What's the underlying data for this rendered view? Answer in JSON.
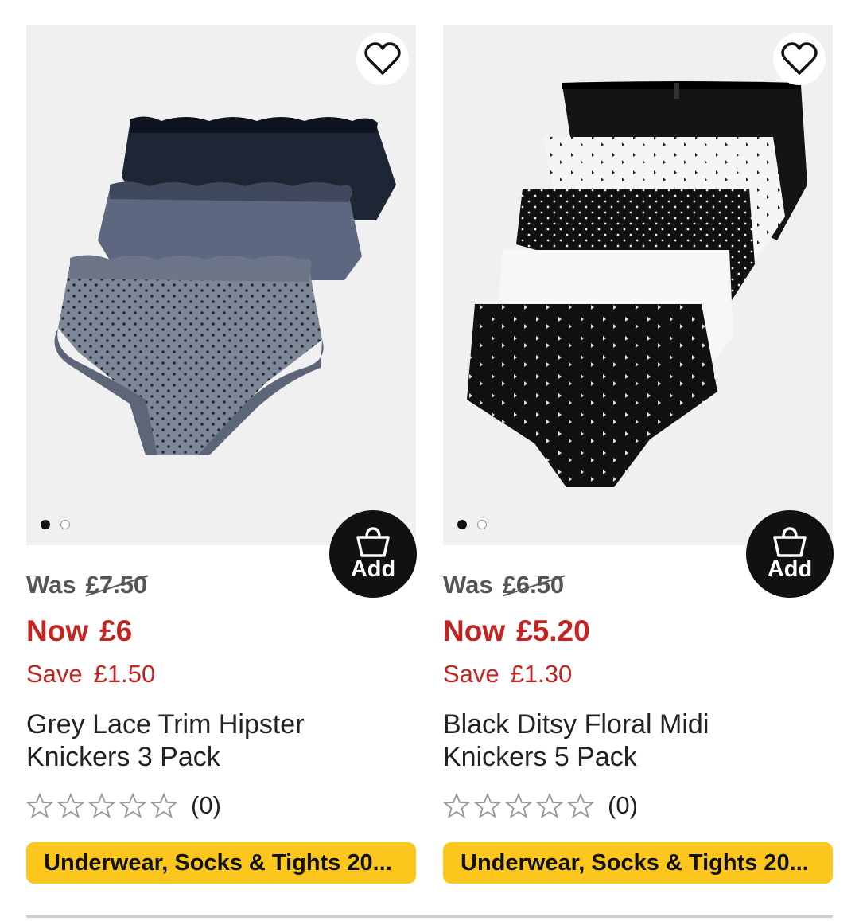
{
  "products": [
    {
      "was_label": "Was",
      "was_price": "£7.50",
      "now_label": "Now",
      "now_price": "£6",
      "save_label": "Save",
      "save_amount": "£1.50",
      "title_line1": "Grey Lace Trim Hipster",
      "title_line2": "Knickers 3 Pack",
      "rating_stars": 0,
      "review_count": "(0)",
      "add_label": "Add",
      "promo": "Underwear, Socks & Tights 20...",
      "image_icon": "product-image-grey-lace-knickers",
      "carousel_active": 1,
      "carousel_total": 2
    },
    {
      "was_label": "Was",
      "was_price": "£6.50",
      "now_label": "Now",
      "now_price": "£5.20",
      "save_label": "Save",
      "save_amount": "£1.30",
      "title_line1": "Black Ditsy Floral Midi",
      "title_line2": "Knickers 5 Pack",
      "rating_stars": 0,
      "review_count": "(0)",
      "add_label": "Add",
      "promo": "Underwear, Socks & Tights 20...",
      "image_icon": "product-image-black-floral-knickers",
      "carousel_active": 1,
      "carousel_total": 2
    }
  ],
  "colors": {
    "sale_red": "#c4231f",
    "promo_yellow": "#fbc71d",
    "add_button": "#111111",
    "image_bg": "#f1f0f0"
  }
}
